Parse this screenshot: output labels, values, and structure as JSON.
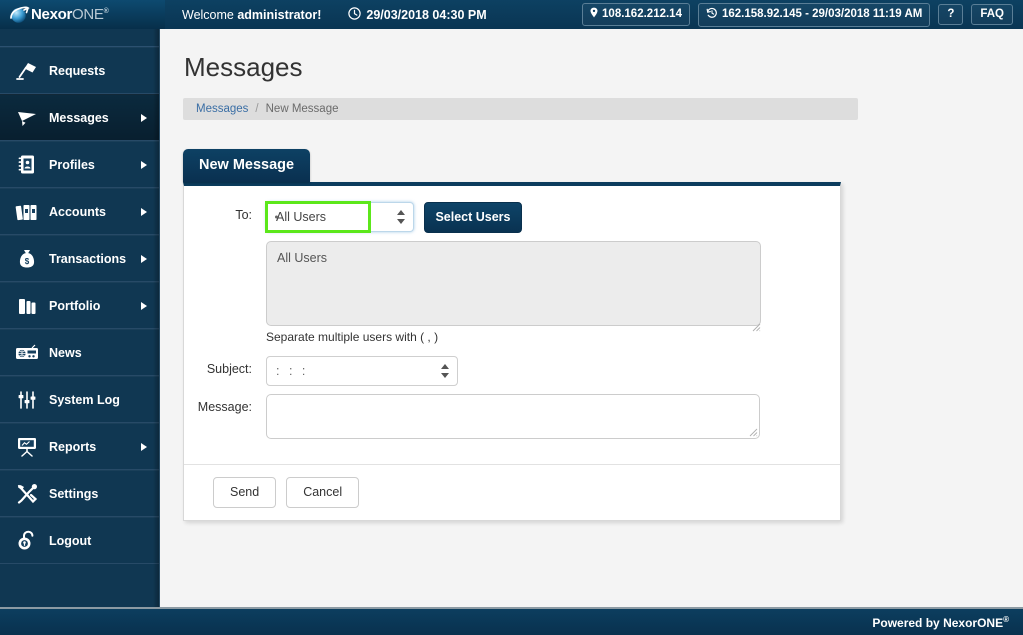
{
  "header": {
    "logo_name": "Nexor",
    "logo_name_second": "ONE",
    "logo_reg": "®",
    "logo_icon": "nexor-orb-logo",
    "welcome_prefix": "Welcome ",
    "welcome_user": "administrator!",
    "clock_icon": "clock-icon",
    "datetime": "29/03/2018 04:30 PM",
    "pin_icon": "location-pin-icon",
    "current_ip": "108.162.212.14",
    "history_icon": "history-clock-icon",
    "last_login": "162.158.92.145 - 29/03/2018 11:19 AM",
    "help_label": "?",
    "faq_label": "FAQ"
  },
  "sidebar": {
    "items": [
      {
        "label": "Requests",
        "icon": "desk-lamp-icon",
        "arrow": false,
        "active": false
      },
      {
        "label": "Messages",
        "icon": "paper-plane-icon",
        "arrow": true,
        "active": true
      },
      {
        "label": "Profiles",
        "icon": "address-book-icon",
        "arrow": true,
        "active": false
      },
      {
        "label": "Accounts",
        "icon": "binders-icon",
        "arrow": true,
        "active": false
      },
      {
        "label": "Transactions",
        "icon": "money-bag-icon",
        "arrow": true,
        "active": false
      },
      {
        "label": "Portfolio",
        "icon": "briefcase-icon",
        "arrow": true,
        "active": false
      },
      {
        "label": "News",
        "icon": "radio-icon",
        "arrow": false,
        "active": false
      },
      {
        "label": "System Log",
        "icon": "sliders-icon",
        "arrow": false,
        "active": false
      },
      {
        "label": "Reports",
        "icon": "presentation-icon",
        "arrow": true,
        "active": false
      },
      {
        "label": "Settings",
        "icon": "wrench-screwdriver-icon",
        "arrow": false,
        "active": false
      },
      {
        "label": "Logout",
        "icon": "open-padlock-icon",
        "arrow": false,
        "active": false
      }
    ]
  },
  "main": {
    "page_title": "Messages",
    "breadcrumb": {
      "link": "Messages",
      "separator": "/",
      "current": "New Message"
    },
    "tab_label": "New Message",
    "form": {
      "to_label": "To:",
      "to_selected": "All Users",
      "to_options": [
        "All Users"
      ],
      "select_users_label": "Select Users",
      "recipients_value": "All Users",
      "recipients_hint": "Separate multiple users with ( , )",
      "subject_label": "Subject:",
      "subject_selected": ": : :",
      "subject_options": [
        ": : :"
      ],
      "message_label": "Message:",
      "message_value": "",
      "send_label": "Send",
      "cancel_label": "Cancel"
    },
    "annotation": {
      "highlight_color": "#5ce71b",
      "target": "to-select"
    }
  },
  "footer": {
    "text": "Powered by NexorONE",
    "reg": "®"
  }
}
